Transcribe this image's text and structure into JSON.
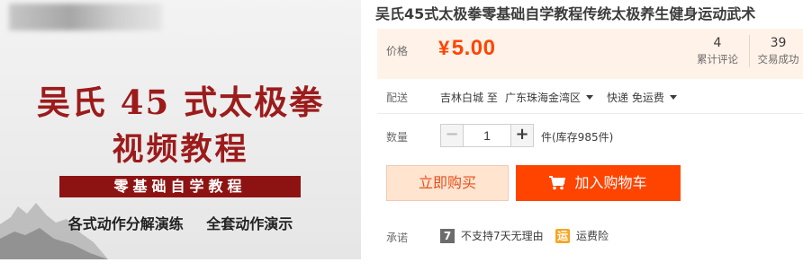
{
  "product": {
    "title": "吴氏45式太极拳零基础自学教程传统太极养生健身运动武术",
    "image": {
      "line1": "吴氏 45 式太极拳",
      "line2": "视频教程",
      "banner": "零基础自学教程",
      "subtitle": "各式动作分解演练 全套动作演示"
    }
  },
  "price": {
    "label": "价格",
    "currency": "¥",
    "amount": "5.00",
    "color": "#ff4400"
  },
  "stats": {
    "reviews": {
      "count": "4",
      "label": "累计评论"
    },
    "trades": {
      "count": "39",
      "label": "交易成功"
    }
  },
  "shipping": {
    "label": "配送",
    "from": "吉林白城 至",
    "to": "广东珠海金湾区",
    "method": "快递 免运费"
  },
  "quantity": {
    "label": "数量",
    "minus": "−",
    "value": "1",
    "plus": "+",
    "stock": "件(库存985件)"
  },
  "actions": {
    "buy_now": "立即购买",
    "add_to_cart": "加入购物车"
  },
  "promise": {
    "label": "承诺",
    "items": [
      {
        "icon": "seven-day-icon",
        "glyph": "7",
        "text": "不支持7天无理由"
      },
      {
        "icon": "freight-insurance-icon",
        "glyph": "运",
        "text": "运费险"
      }
    ]
  }
}
